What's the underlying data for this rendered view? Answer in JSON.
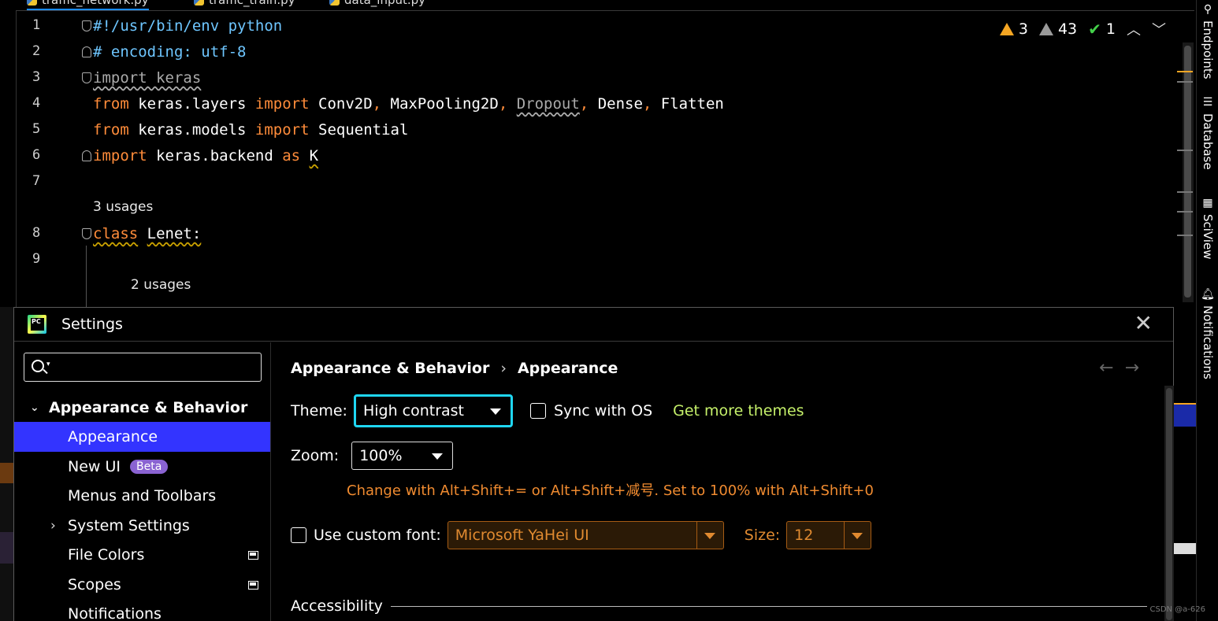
{
  "editor": {
    "tabs": [
      {
        "label": "traffic_network.py",
        "active": true
      },
      {
        "label": "traffic_train.py",
        "active": false
      },
      {
        "label": "data_input.py",
        "active": false
      }
    ],
    "lines": [
      {
        "num": "1",
        "text": "#!/usr/bin/env python"
      },
      {
        "num": "2",
        "text": "# encoding: utf-8"
      },
      {
        "num": "3",
        "text": "import keras"
      },
      {
        "num": "4",
        "text": "from keras.layers import Conv2D, MaxPooling2D, Dropout, Dense, Flatten"
      },
      {
        "num": "5",
        "text": "from keras.models import Sequential"
      },
      {
        "num": "6",
        "text": "import keras.backend as K"
      },
      {
        "num": "7",
        "text": ""
      },
      {
        "num": "8",
        "text": "class Lenet:"
      },
      {
        "num": "9",
        "text": ""
      }
    ],
    "usages_class": "3 usages",
    "usages_method": "2 usages",
    "inspections": {
      "warnings": "3",
      "weak_warnings": "43",
      "typos": "1"
    }
  },
  "right_toolbar": [
    "Endpoints",
    "Database",
    "SciView",
    "Notifications"
  ],
  "dialog": {
    "title": "Settings",
    "close_icon": "close-icon",
    "search": {
      "placeholder": "",
      "value": ""
    },
    "tree": {
      "group": "Appearance & Behavior",
      "items": [
        {
          "label": "Appearance",
          "selected": true
        },
        {
          "label": "New UI",
          "badge": "Beta"
        },
        {
          "label": "Menus and Toolbars"
        },
        {
          "label": "System Settings",
          "expandable": true
        },
        {
          "label": "File Colors"
        },
        {
          "label": "Scopes"
        },
        {
          "label": "Notifications"
        }
      ]
    },
    "breadcrumb": {
      "parent": "Appearance & Behavior",
      "current": "Appearance",
      "separator": "›"
    },
    "theme": {
      "label": "Theme:",
      "value": "High contrast",
      "sync_label": "Sync with OS",
      "sync_checked": false,
      "more_link": "Get more themes"
    },
    "zoom": {
      "label": "Zoom:",
      "value": "100%",
      "hint": "Change with Alt+Shift+= or Alt+Shift+减号. Set to 100% with Alt+Shift+0"
    },
    "font": {
      "checkbox_label": "Use custom font:",
      "checked": false,
      "value": "Microsoft YaHei UI",
      "size_label": "Size:",
      "size_value": "12"
    },
    "section": "Accessibility"
  },
  "watermark": "CSDN @a-626",
  "colors": {
    "selection": "#3334ff",
    "focus_ring": "#1fd6f2",
    "keyword": "#ff8c3a",
    "comment": "#6ec6ff",
    "link": "#c5f06a",
    "hint": "#f08b30"
  }
}
